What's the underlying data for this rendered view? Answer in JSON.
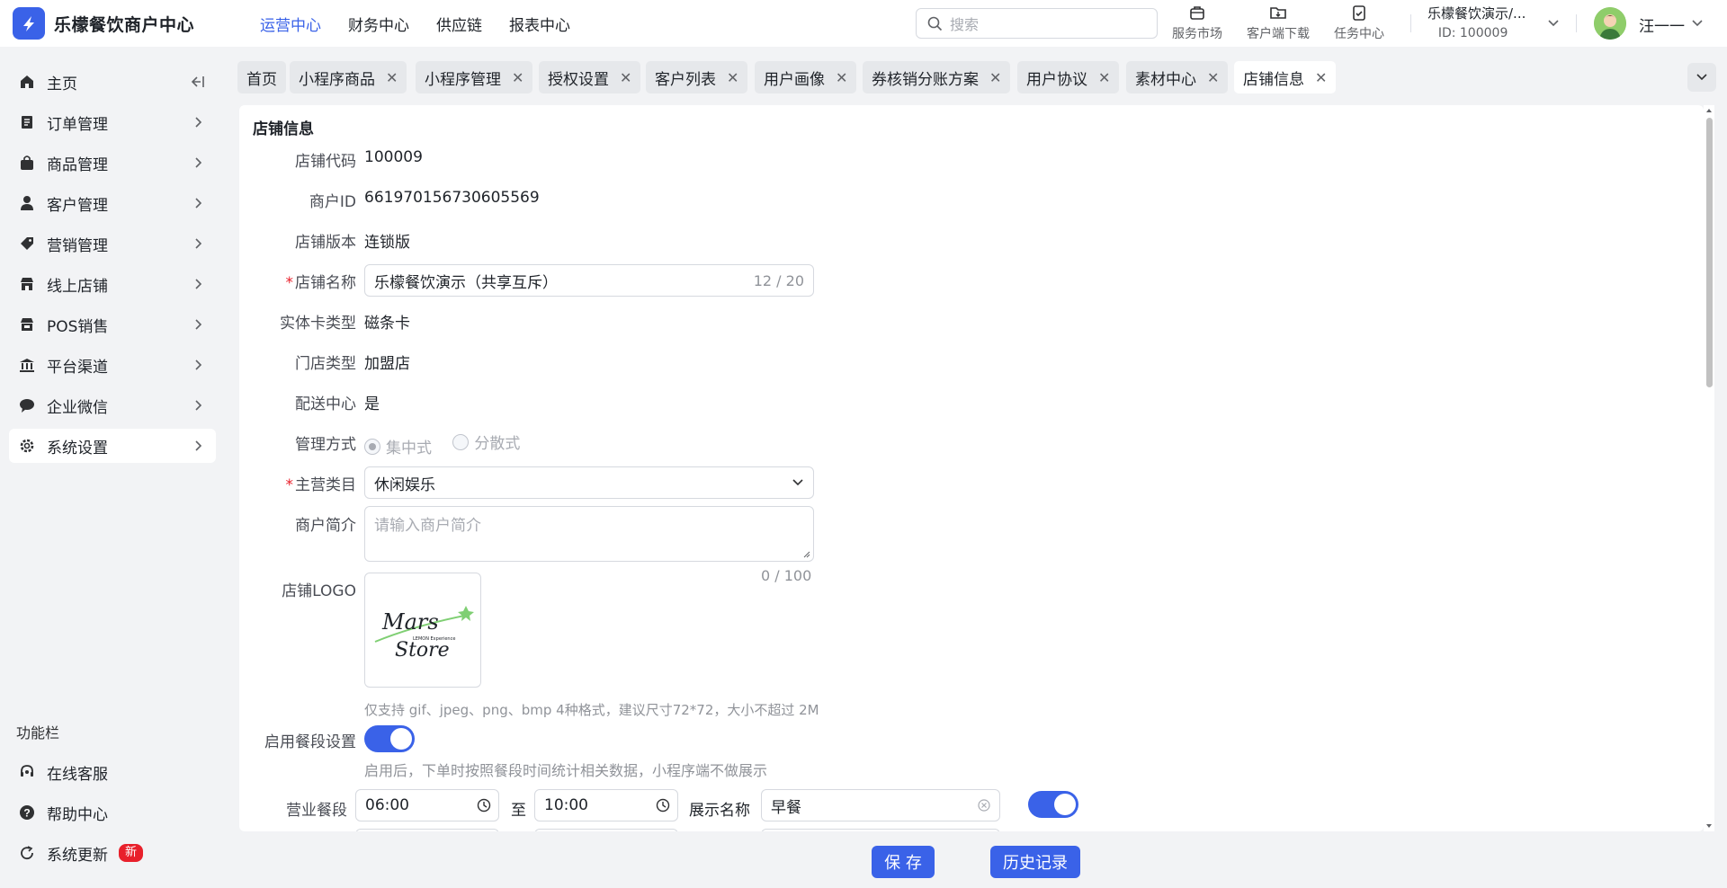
{
  "app": {
    "title": "乐檬餐饮商户中心",
    "accent": "#3a62e8"
  },
  "topnav": [
    {
      "label": "运营中心",
      "active": true
    },
    {
      "label": "财务中心"
    },
    {
      "label": "供应链"
    },
    {
      "label": "报表中心"
    }
  ],
  "search": {
    "placeholder": "搜索"
  },
  "tools": [
    {
      "label": "服务市场",
      "icon": "shop-icon"
    },
    {
      "label": "客户端下载",
      "icon": "folder-download-icon"
    },
    {
      "label": "任务中心",
      "icon": "clipboard-check-icon"
    }
  ],
  "store": {
    "name": "乐檬餐饮演示/...",
    "id": "ID: 100009"
  },
  "user": {
    "name": "汪一一"
  },
  "sidebar": {
    "items": [
      {
        "label": "主页",
        "icon": "home-icon"
      },
      {
        "label": "订单管理",
        "icon": "order-icon"
      },
      {
        "label": "商品管理",
        "icon": "bag-icon"
      },
      {
        "label": "客户管理",
        "icon": "user-icon"
      },
      {
        "label": "营销管理",
        "icon": "tag-icon"
      },
      {
        "label": "线上店铺",
        "icon": "store-icon"
      },
      {
        "label": "POS销售",
        "icon": "pos-icon"
      },
      {
        "label": "平台渠道",
        "icon": "bank-icon"
      },
      {
        "label": "企业微信",
        "icon": "chat-icon"
      },
      {
        "label": "系统设置",
        "icon": "gear-icon",
        "active": true
      }
    ],
    "section_title": "功能栏",
    "bottom": [
      {
        "label": "在线客服",
        "icon": "headset-icon"
      },
      {
        "label": "帮助中心",
        "icon": "help-icon"
      },
      {
        "label": "系统更新",
        "icon": "refresh-icon",
        "badge": "新"
      }
    ]
  },
  "tabs": [
    {
      "label": "首页",
      "closable": false
    },
    {
      "label": "小程序商品",
      "closable": true
    },
    {
      "label": "小程序管理",
      "closable": true
    },
    {
      "label": "授权设置",
      "closable": true
    },
    {
      "label": "客户列表",
      "closable": true
    },
    {
      "label": "用户画像",
      "closable": true
    },
    {
      "label": "券核销分账方案",
      "closable": true
    },
    {
      "label": "用户协议",
      "closable": true
    },
    {
      "label": "素材中心",
      "closable": true
    },
    {
      "label": "店铺信息",
      "closable": true,
      "active": true
    }
  ],
  "form": {
    "title": "店铺信息",
    "store_code_label": "店铺代码",
    "store_code": "100009",
    "merchant_id_label": "商户ID",
    "merchant_id": "661970156730605569",
    "version_label": "店铺版本",
    "version": "连锁版",
    "name_label": "店铺名称",
    "name_value": "乐檬餐饮演示（共享互斥）",
    "name_count": "12 / 20",
    "card_type_label": "实体卡类型",
    "card_type": "磁条卡",
    "shop_type_label": "门店类型",
    "shop_type": "加盟店",
    "delivery_label": "配送中心",
    "delivery": "是",
    "manage_label": "管理方式",
    "manage_options": [
      "集中式",
      "分散式"
    ],
    "category_label": "主营类目",
    "category": "休闲娱乐",
    "intro_label": "商户简介",
    "intro_placeholder": "请输入商户简介",
    "intro_count": "0 / 100",
    "logo_label": "店铺LOGO",
    "logo_text": {
      "line1": "Mars",
      "line2": "Store",
      "small": "LEMON Experience"
    },
    "logo_hint": "仅支持 gif、jpeg、png、bmp 4种格式，建议尺寸72*72，大小不超过 2M",
    "meal_label": "启用餐段设置",
    "meal_enabled": true,
    "meal_hint": "启用后，下单时按照餐段时间统计相关数据，小程序端不做展示",
    "period_label": "营业餐段",
    "period_start": "06:00",
    "period_to": "至",
    "period_end": "10:00",
    "display_name_label": "展示名称",
    "display_name": "早餐",
    "period_enabled": true
  },
  "buttons": {
    "save": "保 存",
    "history": "历史记录"
  }
}
